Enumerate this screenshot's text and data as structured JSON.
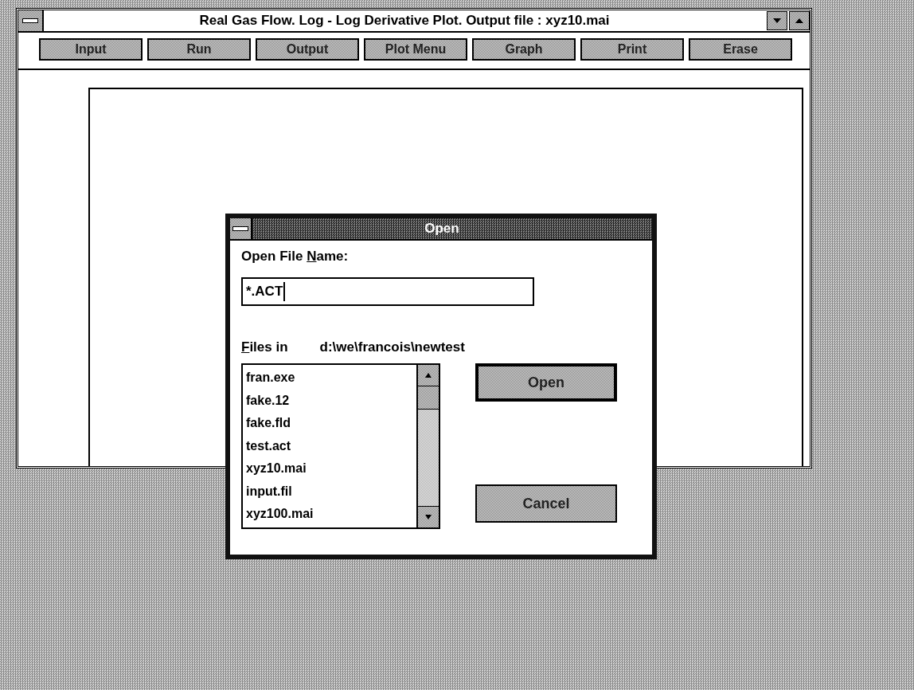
{
  "window": {
    "title": "Real Gas Flow. Log - Log Derivative Plot. Output file : xyz10.mai"
  },
  "toolbar": [
    "Input",
    "Run",
    "Output",
    "Plot Menu",
    "Graph",
    "Print",
    "Erase"
  ],
  "dialog": {
    "title": "Open",
    "file_name_label": {
      "before": "Open File ",
      "key": "N",
      "after": "ame:"
    },
    "file_name": {
      "value": "*.ACT"
    },
    "files_in_label": {
      "key": "F",
      "after": "iles in"
    },
    "directory": "d:\\we\\francois\\newtest",
    "files": [
      "fran.exe",
      "fake.12",
      "fake.fld",
      "test.act",
      "xyz10.mai",
      "input.fil",
      "xyz100.mai"
    ],
    "buttons": [
      "Open",
      "Cancel"
    ]
  }
}
